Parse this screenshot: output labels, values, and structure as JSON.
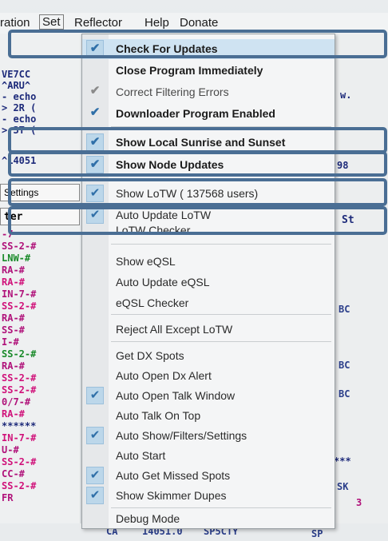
{
  "menubar": {
    "items": [
      "ration",
      "Set",
      "Reflector",
      "Help",
      "Donate"
    ]
  },
  "left_panel": {
    "rows": [
      "VE7CC",
      "^ARU^",
      "- echo",
      "> 2R (",
      "- echo",
      "> 3T (",
      "^14051",
      "Settings",
      "ter",
      "-7",
      "SS-2-#",
      "LNW-#",
      "RA-#",
      "RA-#",
      "IN-7-#",
      "SS-2-#",
      "RA-#",
      "SS-#",
      "I-#",
      "SS-2-#",
      "RA-#",
      "SS-2-#",
      "SS-2-#",
      "0/7-#",
      "RA-#",
      "******",
      "IN-7-#",
      "U-#",
      "SS-2-#",
      "CC-#",
      "SS-2-#",
      "FR"
    ]
  },
  "right_panel": {
    "rows": [
      "w.",
      "98",
      "St",
      "BC",
      "BC",
      "BC",
      "***",
      "SK",
      "3",
      "SP"
    ]
  },
  "menu": {
    "items": [
      {
        "label": "Check For Updates",
        "checked": true,
        "bold": true
      },
      {
        "label": "Close Program Immediately",
        "checked": false,
        "bold": true
      },
      {
        "label": "Correct Filtering Errors",
        "checked": true,
        "bold": true
      },
      {
        "label": "Downloader Program Enabled",
        "checked": true,
        "bold": true
      },
      {
        "label": "Show Local Sunrise and Sunset",
        "checked": true,
        "bold": true
      },
      {
        "label": "Show Node Updates",
        "checked": true,
        "bold": true
      },
      {
        "label": "Show LoTW ( 137568 users)",
        "checked": true,
        "bold": false
      },
      {
        "label": "Auto Update LoTW",
        "checked": true,
        "bold": false
      },
      {
        "label": "LoTW Checker",
        "checked": false,
        "bold": false
      },
      {
        "label": "Show eQSL",
        "checked": false,
        "bold": false
      },
      {
        "label": "Auto Update eQSL",
        "checked": false,
        "bold": false
      },
      {
        "label": "eQSL Checker",
        "checked": false,
        "bold": false
      },
      {
        "label": "Reject All Except LoTW",
        "checked": false,
        "bold": false
      },
      {
        "label": "Get DX Spots",
        "checked": false,
        "bold": false
      },
      {
        "label": "Auto Open Dx Alert",
        "checked": false,
        "bold": false
      },
      {
        "label": "Auto Open Talk Window",
        "checked": true,
        "bold": false
      },
      {
        "label": "Auto Talk On Top",
        "checked": false,
        "bold": false
      },
      {
        "label": "Auto Show/Filters/Settings",
        "checked": true,
        "bold": false
      },
      {
        "label": "Auto Start",
        "checked": false,
        "bold": false
      },
      {
        "label": "Auto Get Missed Spots",
        "checked": true,
        "bold": false
      },
      {
        "label": "Show Skimmer Dupes",
        "checked": true,
        "bold": false
      },
      {
        "label": "Debug Mode",
        "checked": false,
        "bold": false
      }
    ]
  },
  "bottom_line": {
    "band": "CA",
    "freq": "14051.0",
    "call": "SP5CTY",
    "tail": "SP"
  },
  "colors": {
    "check_bg": "#bcd7ea",
    "check_mark": "#2f6fa8",
    "annotation_border": "#4a6e94",
    "highlight": "#cfe3f2"
  }
}
